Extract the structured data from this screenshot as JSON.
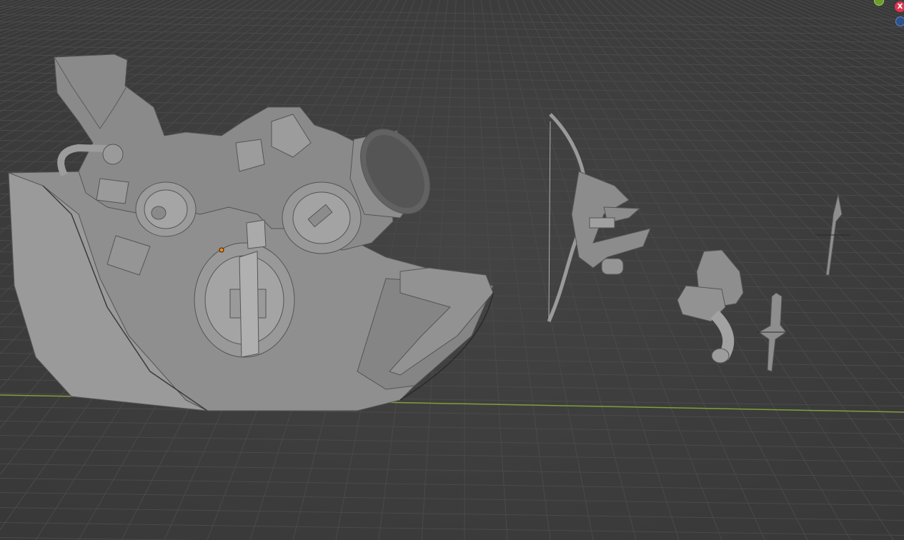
{
  "viewport": {
    "background_color": "#3d3d3d",
    "grid_color": "#4a4a4a",
    "x_axis_color": "#7ea03a",
    "mesh_color": "#8c8c8c"
  },
  "gizmo": {
    "x_label": "X",
    "x_color": "#e0344f",
    "y_color": "#6b9a2e",
    "z_color": "#2f5189"
  },
  "objects": [
    {
      "name": "mechanical-shield",
      "selected": true,
      "origin_color": "#f28a1e"
    },
    {
      "name": "bow"
    },
    {
      "name": "gauntlet-arm-cannon"
    },
    {
      "name": "short-sword"
    },
    {
      "name": "spear"
    }
  ]
}
